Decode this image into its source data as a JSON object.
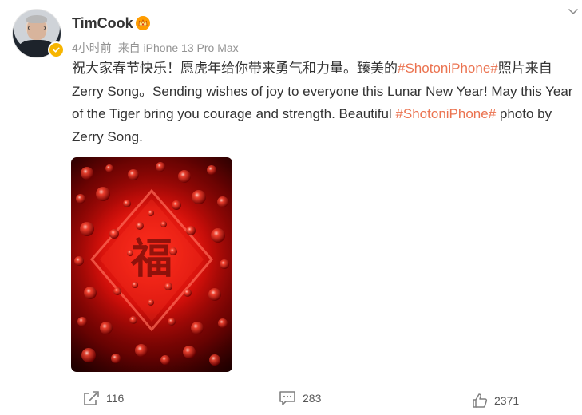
{
  "post": {
    "author": {
      "name": "TimCook",
      "avatar_icon": "user-avatar",
      "badge_icon": "crown-icon",
      "verify_icon": "verified-badge-icon"
    },
    "meta": {
      "time": "4小时前",
      "source": "来自 iPhone 13 Pro Max"
    },
    "text": {
      "p1": "祝大家春节快乐！愿虎年给你带来勇气和力量。臻美的",
      "topic1": "#ShotoniPhone#",
      "p2": "照片来自 Zerry Song。Sending wishes of joy to everyone this Lunar New Year! May this Year of the Tiger bring you courage and strength. Beautiful ",
      "topic2": "#ShotoniPhone#",
      "p3": " photo by Zerry Song."
    },
    "image": {
      "description_icon": "red-water-droplets-photo",
      "dominant_color": "#d30f0a"
    },
    "actions": {
      "repost": "116",
      "comment": "283",
      "like": "2371"
    }
  },
  "colors": {
    "topic": "#eb7350",
    "meta": "#939393",
    "text": "#333333",
    "badge": "#f7b500"
  }
}
